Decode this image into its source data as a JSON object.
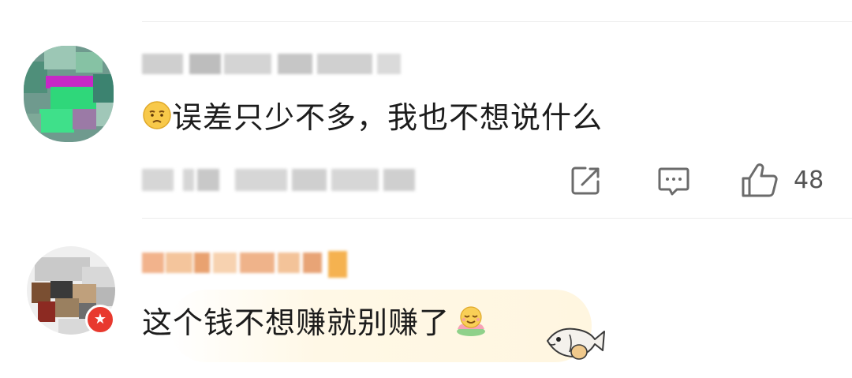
{
  "comments": [
    {
      "text": "误差只少不多，我也不想说什么",
      "reaction_emoji": "sad-face-emoji",
      "actions": {
        "share_icon": "share-icon",
        "reply_icon": "comment-icon",
        "like_icon": "thumbs-up-icon",
        "like_count": "48"
      }
    },
    {
      "text": "这个钱不想赚就别赚了",
      "reaction_emoji": "lotus-smile-emoji",
      "badge_icon": "star-badge-icon",
      "decoration": "fish-sticker"
    }
  ],
  "colors": {
    "divider": "#ececec",
    "text": "#1c1c1c",
    "icon": "#6b6b6b",
    "badge": "#e8392e",
    "bubble": "#fff6e0"
  }
}
